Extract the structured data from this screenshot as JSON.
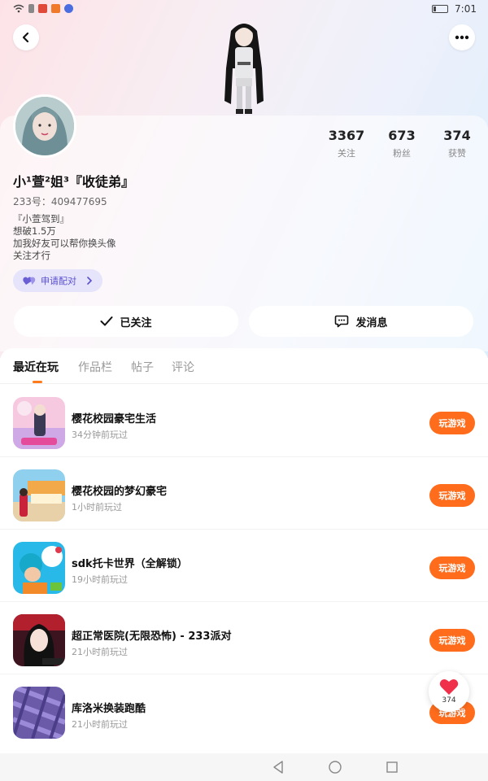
{
  "status_bar": {
    "time": "7:01"
  },
  "header": {
    "back_icon": "chevron-left-icon",
    "more_icon": "ellipsis-icon"
  },
  "profile": {
    "nickname": "小¹萱²姐³『收徒弟』",
    "uid": "233号：409477695",
    "bio": [
      "『小萱驾到』",
      "想破1.5万",
      "加我好友可以帮你换头像",
      "关注才行"
    ],
    "pair_button": "申请配对",
    "stats": [
      {
        "value": "3367",
        "label": "关注"
      },
      {
        "value": "673",
        "label": "粉丝"
      },
      {
        "value": "374",
        "label": "获赞"
      }
    ]
  },
  "actions": {
    "follow_label": "已关注",
    "message_label": "发消息"
  },
  "tabs": [
    {
      "label": "最近在玩",
      "active": true
    },
    {
      "label": "作品栏",
      "active": false
    },
    {
      "label": "帖子",
      "active": false
    },
    {
      "label": "评论",
      "active": false
    }
  ],
  "games": [
    {
      "title": "樱花校园豪宅生活",
      "time": "34分钟前玩过",
      "button": "玩游戏"
    },
    {
      "title": "樱花校园的梦幻豪宅",
      "time": "1小时前玩过",
      "button": "玩游戏"
    },
    {
      "title": "sdk托卡世界（全解锁）",
      "time": "19小时前玩过",
      "button": "玩游戏"
    },
    {
      "title": "超正常医院(无限恐怖) - 233派对",
      "time": "21小时前玩过",
      "button": "玩游戏"
    },
    {
      "title": "库洛米换装跑酷",
      "time": "21小时前玩过",
      "button": "玩游戏"
    }
  ],
  "like_float": {
    "count": "374"
  },
  "colors": {
    "accent": "#ff6d1c",
    "pair_bg": "#e5e4fb",
    "pair_text": "#5b4fcf"
  }
}
